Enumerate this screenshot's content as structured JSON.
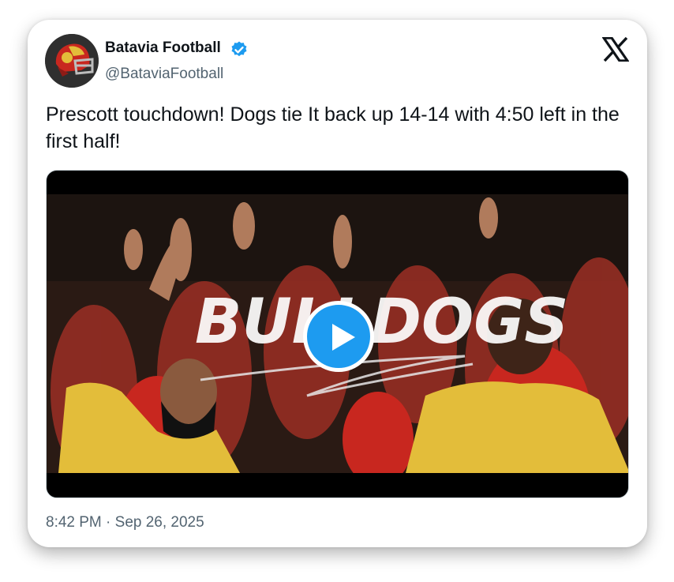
{
  "tweet": {
    "author_name": "Batavia Football",
    "handle": "@BataviaFootball",
    "verified": true,
    "text": "Prescott touchdown! Dogs tie It back up 14-14 with 4:50 left in the first half!",
    "timestamp": "8:42 PM · Sep 26, 2025"
  },
  "media": {
    "type": "video",
    "overlay_text": "BULLDOGS",
    "play_icon": "play-icon"
  },
  "icons": {
    "verified": "verified-badge-icon",
    "platform": "x-logo-icon"
  },
  "colors": {
    "accent": "#1d9bf0",
    "text_primary": "#0f1419",
    "text_secondary": "#536471",
    "jersey_red": "#c8271f",
    "jersey_gold": "#e3bd3a"
  }
}
